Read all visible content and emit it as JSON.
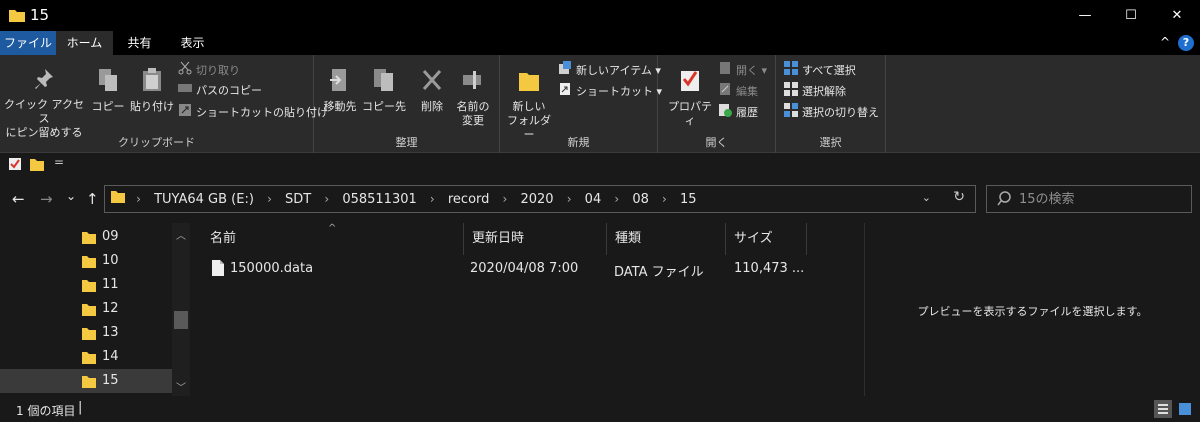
{
  "window": {
    "title": "15",
    "minimize": "—",
    "maximize": "☐",
    "close": "✕"
  },
  "tabs": {
    "file": "ファイル",
    "home": "ホーム",
    "share": "共有",
    "view": "表示",
    "collapse": "^",
    "help": "?"
  },
  "ribbon": {
    "clipboard": {
      "label": "クリップボード",
      "pin_line1": "クイック アクセス",
      "pin_line2": "にピン留めする",
      "copy": "コピー",
      "paste": "貼り付け",
      "cut": "切り取り",
      "copy_path": "パスのコピー",
      "paste_shortcut": "ショートカットの貼り付け"
    },
    "organize": {
      "label": "整理",
      "move_to": "移動先",
      "copy_to": "コピー先",
      "delete": "削除",
      "rename_line1": "名前の",
      "rename_line2": "変更"
    },
    "new": {
      "label": "新規",
      "new_folder_line1": "新しい",
      "new_folder_line2": "フォルダー",
      "new_item": "新しいアイテム ▾",
      "shortcut": "ショートカット ▾"
    },
    "open": {
      "label": "開く",
      "properties": "プロパティ",
      "open": "開く ▾",
      "edit": "編集",
      "history": "履歴"
    },
    "select": {
      "label": "選択",
      "select_all": "すべて選択",
      "select_none": "選択解除",
      "invert": "選択の切り替え"
    }
  },
  "qat": {
    "dropdown": "="
  },
  "address": {
    "back": "←",
    "forward": "→",
    "recent": "⌄",
    "up": "↑",
    "crumbs": [
      "TUYA64 GB (E:)",
      "SDT",
      "058511301",
      "record",
      "2020",
      "04",
      "08",
      "15"
    ],
    "dropdown": "⌄",
    "refresh": "↻"
  },
  "search": {
    "placeholder": "15の検索"
  },
  "nav": {
    "items": [
      "09",
      "10",
      "11",
      "12",
      "13",
      "14",
      "15"
    ],
    "selected": "15"
  },
  "filelist": {
    "columns": {
      "name": "名前",
      "date": "更新日時",
      "type": "種類",
      "size": "サイズ"
    },
    "rows": [
      {
        "name": "150000.data",
        "date": "2020/04/08 7:00",
        "type": "DATA ファイル",
        "size": "110,473 ..."
      }
    ]
  },
  "preview": {
    "message": "プレビューを表示するファイルを選択します。"
  },
  "status": {
    "count": "1 個の項目",
    "cursor": "|"
  },
  "colors": {
    "accent": "#1e5aa0",
    "folder": "#f5c842",
    "background": "#191919",
    "ribbon": "#2b2b2b"
  }
}
